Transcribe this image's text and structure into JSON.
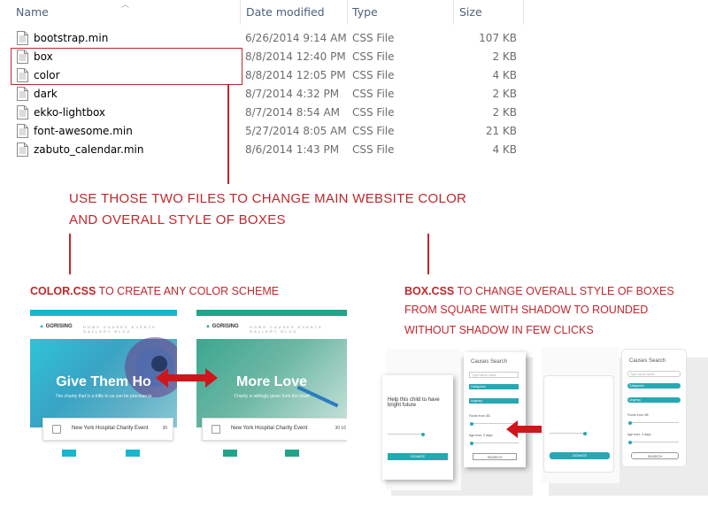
{
  "explorer": {
    "columns": {
      "name": "Name",
      "date": "Date modified",
      "type": "Type",
      "size": "Size"
    },
    "files": [
      {
        "name": "bootstrap.min",
        "date": "6/26/2014 9:14 AM",
        "type": "CSS File",
        "size": "107 KB"
      },
      {
        "name": "box",
        "date": "8/8/2014 12:40 PM",
        "type": "CSS File",
        "size": "2 KB"
      },
      {
        "name": "color",
        "date": "8/8/2014 12:05 PM",
        "type": "CSS File",
        "size": "4 KB"
      },
      {
        "name": "dark",
        "date": "8/7/2014 4:32 PM",
        "type": "CSS File",
        "size": "2 KB"
      },
      {
        "name": "ekko-lightbox",
        "date": "8/7/2014 8:54 AM",
        "type": "CSS File",
        "size": "2 KB"
      },
      {
        "name": "font-awesome.min",
        "date": "5/27/2014 8:05 AM",
        "type": "CSS File",
        "size": "21 KB"
      },
      {
        "name": "zabuto_calendar.min",
        "date": "8/6/2014 1:43 PM",
        "type": "CSS File",
        "size": "4 KB"
      }
    ]
  },
  "notes": {
    "main_line1": "USE THOSE TWO FILES TO CHANGE MAIN WEBSITE COLOR",
    "main_line2": "AND OVERALL STYLE OF BOXES",
    "color_title": "COLOR.CSS",
    "color_text": " TO CREATE ANY COLOR SCHEME",
    "box_title": "BOX.CSS",
    "box_text_1": " TO CHANGE OVERALL STYLE OF BOXES",
    "box_text_2": "FROM SQUARE WITH SHADOW TO ROUNDED",
    "box_text_3": "WITHOUT SHADOW IN FEW CLICKS"
  },
  "mock_left": {
    "logo": "GORISING",
    "hero_title": "Give Them Ho",
    "hero_sub": "The charity that is a trifle to us can be precious to",
    "event": "New York Hospital Charity Event",
    "event_num": "30",
    "accent": "#17b7d0"
  },
  "mock_right": {
    "logo": "GORISING",
    "hero_title": "More Love",
    "hero_sub": "Charity is willingly given from the heart",
    "event": "New York Hospital Charity Event",
    "event_num": "30  16",
    "accent": "#1fa58a"
  },
  "box_mock": {
    "card_text": "Help this child to have bright future",
    "search_title": "Causes Search",
    "search_placeholder": "Type cause name",
    "select_1": "Categories",
    "select_2": "Urgency",
    "funds_label": "Funds from: $5",
    "age_label": "Age from: 3 days",
    "donate": "DONATE",
    "search_btn": "SEARCH",
    "accent": "#26a8b3"
  },
  "colors": {
    "annotation": "#c0272d"
  }
}
